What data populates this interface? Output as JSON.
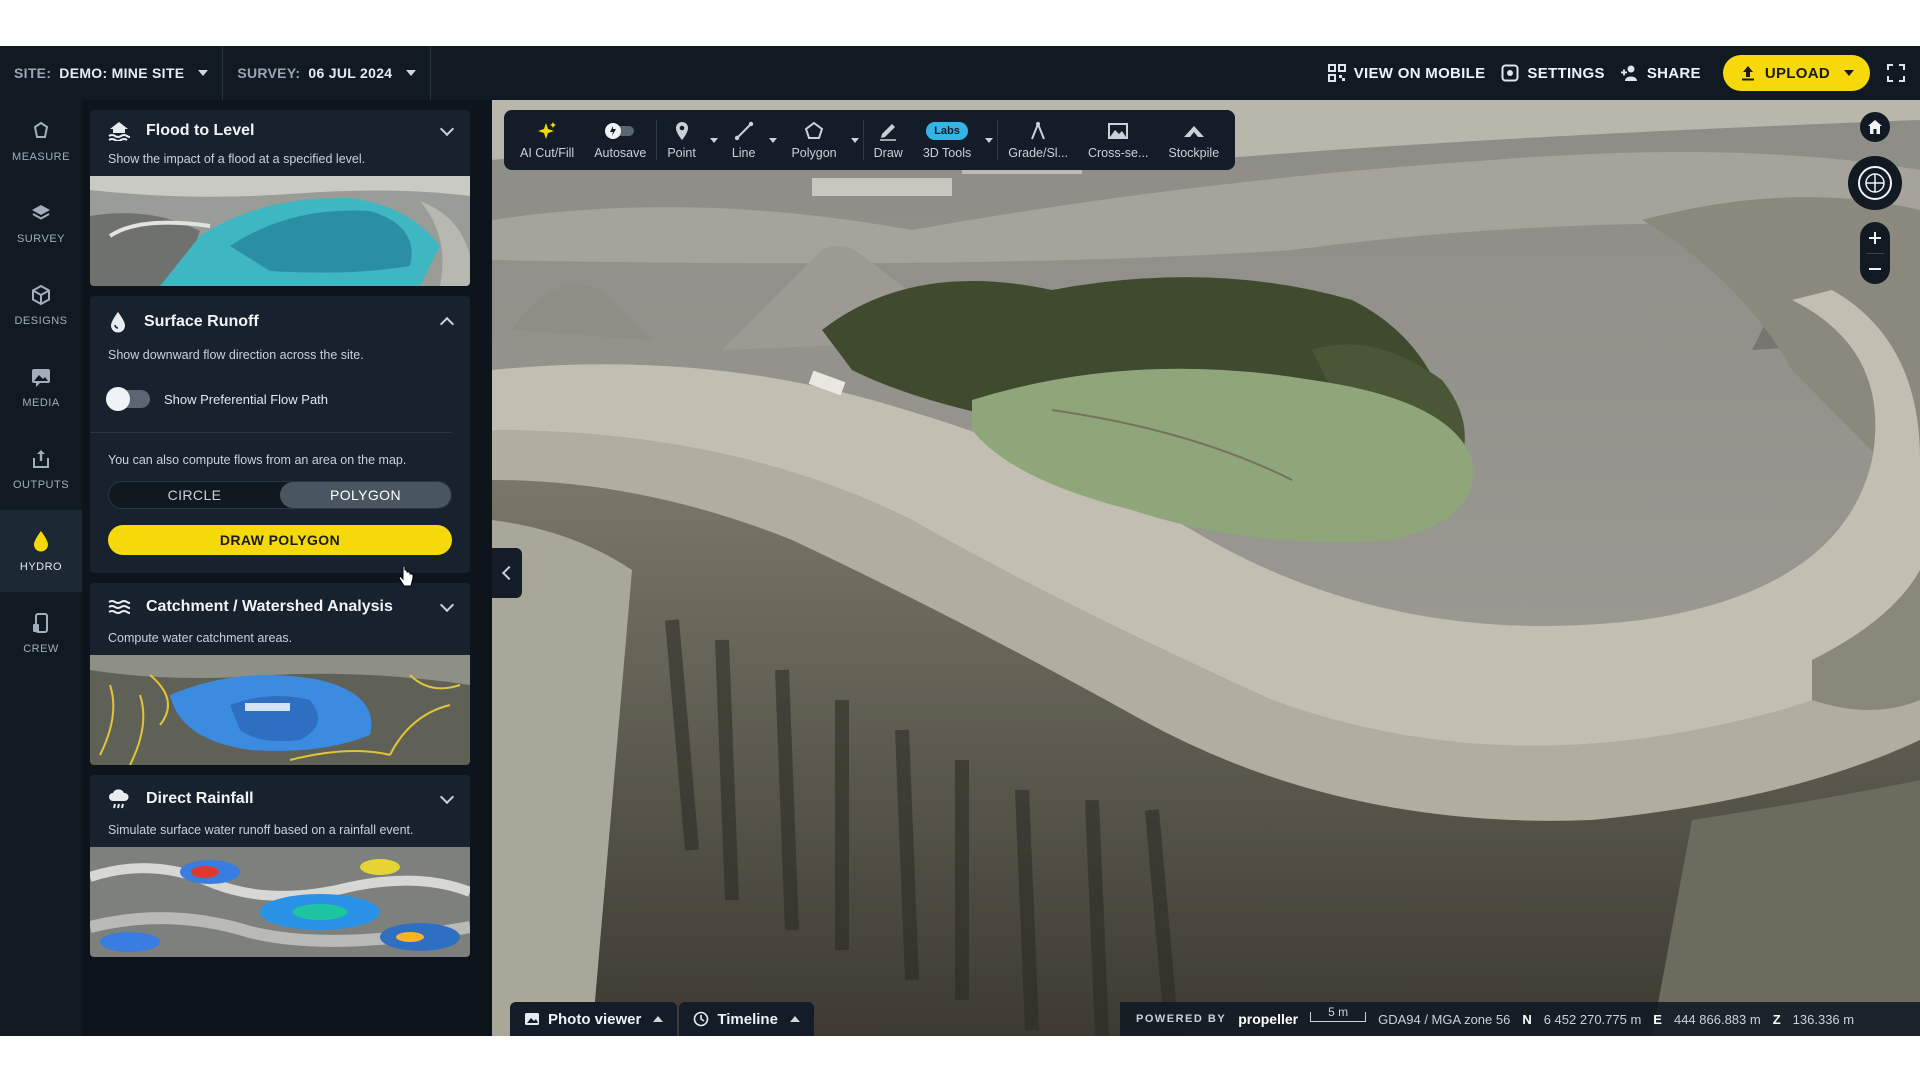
{
  "topbar": {
    "site_label": "SITE:",
    "site_value": "DEMO: MINE SITE",
    "survey_label": "SURVEY:",
    "survey_value": "06 JUL 2024",
    "view_on_mobile": "VIEW ON MOBILE",
    "settings": "SETTINGS",
    "share": "SHARE",
    "upload": "UPLOAD"
  },
  "rail": {
    "items": [
      {
        "label": "MEASURE",
        "icon": "measure-icon"
      },
      {
        "label": "SURVEY",
        "icon": "layers-icon"
      },
      {
        "label": "DESIGNS",
        "icon": "cube-icon"
      },
      {
        "label": "MEDIA",
        "icon": "image-icon"
      },
      {
        "label": "OUTPUTS",
        "icon": "export-icon"
      },
      {
        "label": "HYDRO",
        "icon": "drop-icon"
      },
      {
        "label": "CREW",
        "icon": "phone-icon"
      }
    ],
    "active": "HYDRO"
  },
  "panel": {
    "flood": {
      "title": "Flood to Level",
      "desc": "Show the impact of a flood at a specified level."
    },
    "runoff": {
      "title": "Surface Runoff",
      "desc": "Show downward flow direction across the site.",
      "toggle_label": "Show Preferential Flow Path",
      "toggle_on": false,
      "compute_text": "You can also compute flows from an area on the map.",
      "seg_circle": "CIRCLE",
      "seg_polygon": "POLYGON",
      "selected": "POLYGON",
      "draw_button": "DRAW POLYGON"
    },
    "catchment": {
      "title": "Catchment / Watershed Analysis",
      "desc": "Compute water catchment areas."
    },
    "rainfall": {
      "title": "Direct Rainfall",
      "desc": "Simulate surface water runoff based on a rainfall event."
    }
  },
  "toolbar": {
    "tools": [
      "AI Cut/Fill",
      "Autosave",
      "Point",
      "Line",
      "Polygon",
      "Draw",
      "3D Tools",
      "Grade/Sl...",
      "Cross-se...",
      "Stockpile"
    ],
    "labs_badge": "Labs"
  },
  "bottom": {
    "photo_viewer": "Photo viewer",
    "timeline": "Timeline"
  },
  "status": {
    "powered_by": "POWERED BY",
    "brand": "propeller",
    "scale": "5 m",
    "crs": "GDA94 / MGA zone 56",
    "n_label": "N",
    "n_value": "6 452 270.775 m",
    "e_label": "E",
    "e_value": "444 866.883 m",
    "z_label": "Z",
    "z_value": "136.336 m"
  },
  "colors": {
    "accent_yellow": "#f6d90a",
    "labs_blue": "#33b4e8",
    "water_green": "#8fa67a"
  }
}
